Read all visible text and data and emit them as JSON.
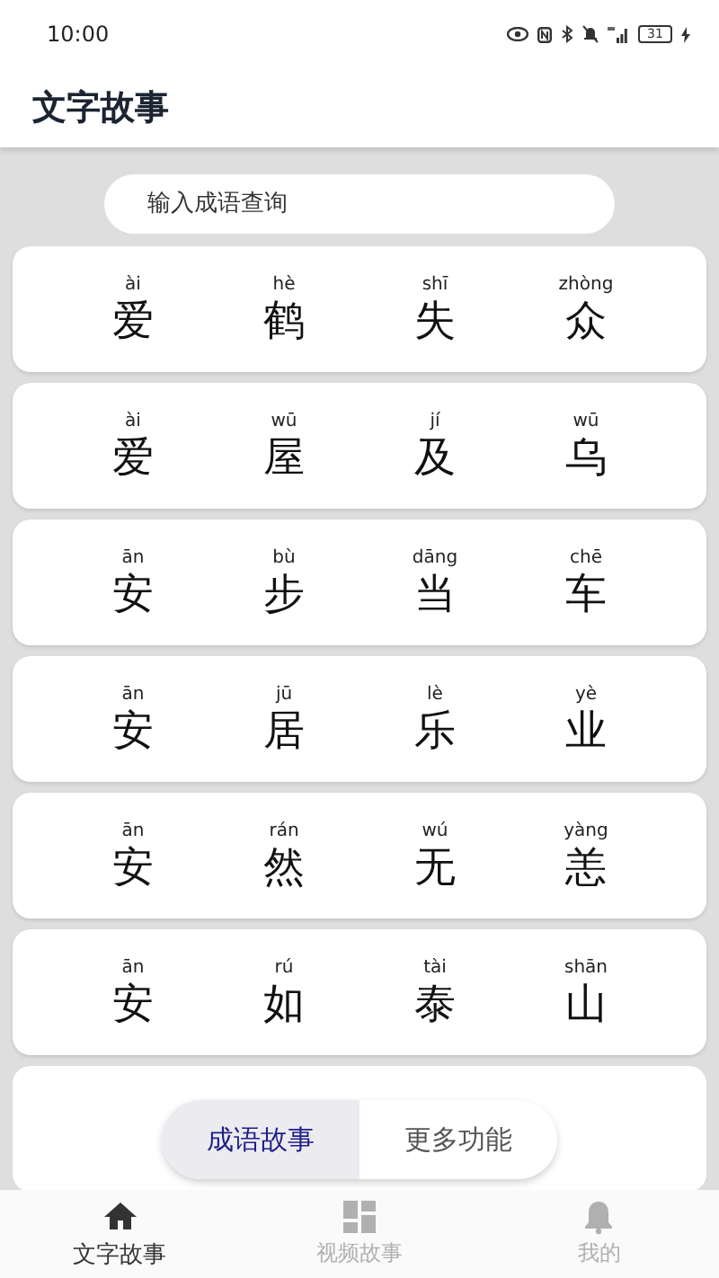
{
  "status_bar": {
    "time": "10:00",
    "battery": "31"
  },
  "app_bar": {
    "title": "文字故事"
  },
  "search": {
    "placeholder": "输入成语查询"
  },
  "idioms": [
    {
      "chars": [
        {
          "pinyin": "ài",
          "hanzi": "爱"
        },
        {
          "pinyin": "hè",
          "hanzi": "鹤"
        },
        {
          "pinyin": "shī",
          "hanzi": "失"
        },
        {
          "pinyin": "zhòng",
          "hanzi": "众"
        }
      ]
    },
    {
      "chars": [
        {
          "pinyin": "ài",
          "hanzi": "爱"
        },
        {
          "pinyin": "wū",
          "hanzi": "屋"
        },
        {
          "pinyin": "jí",
          "hanzi": "及"
        },
        {
          "pinyin": "wū",
          "hanzi": "乌"
        }
      ]
    },
    {
      "chars": [
        {
          "pinyin": "ān",
          "hanzi": "安"
        },
        {
          "pinyin": "bù",
          "hanzi": "步"
        },
        {
          "pinyin": "dāng",
          "hanzi": "当"
        },
        {
          "pinyin": "chē",
          "hanzi": "车"
        }
      ]
    },
    {
      "chars": [
        {
          "pinyin": "ān",
          "hanzi": "安"
        },
        {
          "pinyin": "jū",
          "hanzi": "居"
        },
        {
          "pinyin": "lè",
          "hanzi": "乐"
        },
        {
          "pinyin": "yè",
          "hanzi": "业"
        }
      ]
    },
    {
      "chars": [
        {
          "pinyin": "ān",
          "hanzi": "安"
        },
        {
          "pinyin": "rán",
          "hanzi": "然"
        },
        {
          "pinyin": "wú",
          "hanzi": "无"
        },
        {
          "pinyin": "yàng",
          "hanzi": "恙"
        }
      ]
    },
    {
      "chars": [
        {
          "pinyin": "ān",
          "hanzi": "安"
        },
        {
          "pinyin": "rú",
          "hanzi": "如"
        },
        {
          "pinyin": "tài",
          "hanzi": "泰"
        },
        {
          "pinyin": "shān",
          "hanzi": "山"
        }
      ]
    }
  ],
  "segments": [
    {
      "label": "成语故事",
      "selected": true
    },
    {
      "label": "更多功能",
      "selected": false
    }
  ],
  "bottom_nav": [
    {
      "label": "文字故事",
      "kind": "home",
      "selected": true
    },
    {
      "label": "视频故事",
      "kind": "grid",
      "selected": false
    },
    {
      "label": "我的",
      "kind": "bell",
      "selected": false
    }
  ]
}
